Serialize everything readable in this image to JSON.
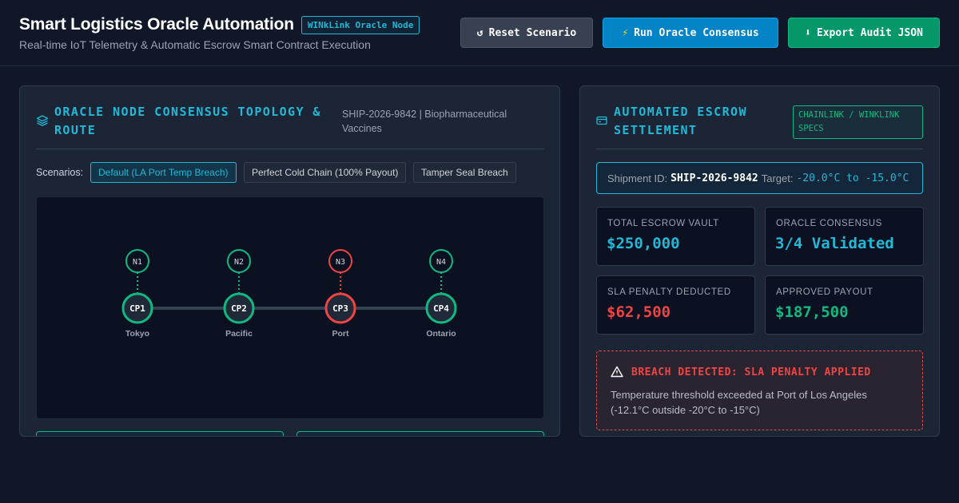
{
  "header": {
    "title": "Smart Logistics Oracle Automation",
    "badge": "WINkLink Oracle Node",
    "subtitle": "Real-time IoT Telemetry & Automatic Escrow Smart Contract Execution",
    "buttons": {
      "reset": "Reset Scenario",
      "reset_icon": "↺",
      "run": "Run Oracle Consensus",
      "run_icon": "⚡",
      "export": "Export Audit JSON",
      "export_icon": "⬇"
    }
  },
  "topology_panel": {
    "title_line1": "ORACLE NODE CONSENSUS TOPOLOGY &",
    "title_line2": "ROUTE",
    "shipment_line1": "SHIP-2026-9842 | Biopharmaceutical",
    "shipment_line2": "Vaccines",
    "scenarios_label": "Scenarios:",
    "scenarios": [
      {
        "label": "Default (LA Port Temp Breach)",
        "active": true
      },
      {
        "label": "Perfect Cold Chain (100% Payout)",
        "active": false
      },
      {
        "label": "Tamper Seal Breach",
        "active": false
      }
    ],
    "nodes": [
      {
        "node": "N1",
        "checkpoint": "CP1",
        "location": "Tokyo",
        "status": "ok"
      },
      {
        "node": "N2",
        "checkpoint": "CP2",
        "location": "Pacific",
        "status": "ok"
      },
      {
        "node": "N3",
        "checkpoint": "CP3",
        "location": "Port",
        "status": "breach"
      },
      {
        "node": "N4",
        "checkpoint": "CP4",
        "location": "Ontario",
        "status": "ok"
      }
    ]
  },
  "escrow_panel": {
    "title_line1": "AUTOMATED ESCROW",
    "title_line2": "SETTLEMENT",
    "spec_badge_line1": "CHAINLINK / WINKLINK",
    "spec_badge_line2": "SPECS",
    "shipment_label": "Shipment ID:",
    "shipment_id": "SHIP-2026-9842",
    "target_label": "Target:",
    "target_range": "-20.0°C to -15.0°C",
    "stats": {
      "vault_label": "TOTAL ESCROW VAULT",
      "vault_value": "$250,000",
      "consensus_label": "ORACLE CONSENSUS",
      "consensus_value": "3/4 Validated",
      "penalty_label": "SLA PENALTY DEDUCTED",
      "penalty_value": "$62,500",
      "payout_label": "APPROVED PAYOUT",
      "payout_value": "$187,500"
    },
    "breach": {
      "title": "BREACH DETECTED: SLA PENALTY APPLIED",
      "line1": "Temperature threshold exceeded at Port of Los Angeles",
      "line2": "(-12.1°C outside -20°C to -15°C)"
    }
  },
  "colors": {
    "accent": "#22b8d6",
    "ok": "#10b981",
    "breach": "#ef4444",
    "background": "#0f1729"
  }
}
